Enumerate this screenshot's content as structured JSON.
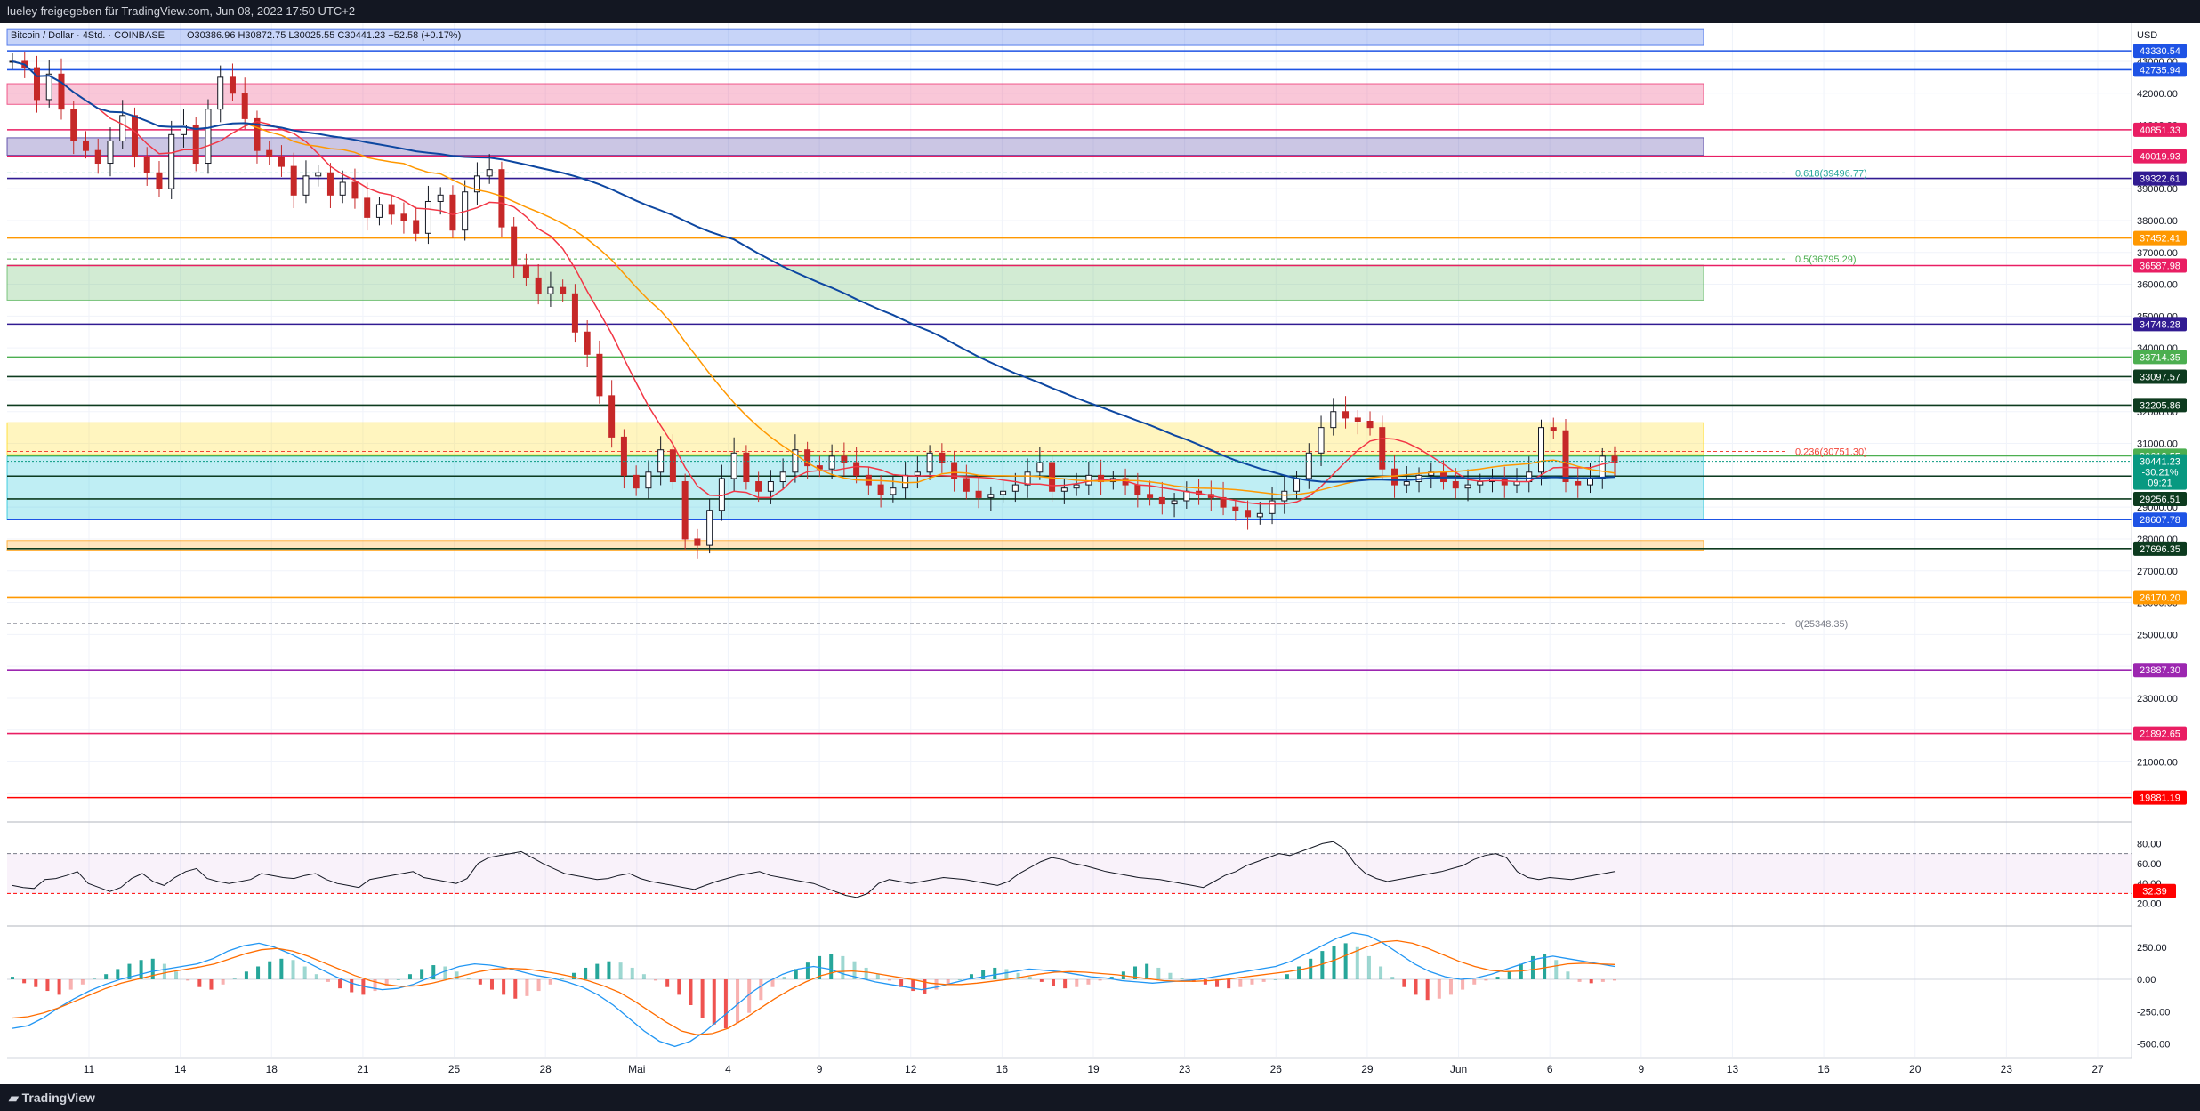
{
  "header": {
    "caption": "lueley freigegeben für TradingView.com, Jun 08, 2022 17:50 UTC+2"
  },
  "footer": {
    "brand": "TradingView"
  },
  "chart_data": {
    "type": "candlestick",
    "symbol_line": "Bitcoin / Dollar · 4Std. · COINBASE",
    "ohlc_readout": "O30386.96 H30872.75 L30025.55 C30441.23 +52.58 (+0.17%)",
    "currency": "USD",
    "x_ticks": [
      "11",
      "14",
      "18",
      "21",
      "25",
      "28",
      "Mai",
      "4",
      "9",
      "12",
      "16",
      "19",
      "23",
      "26",
      "29",
      "Jun",
      "6",
      "9",
      "13",
      "16",
      "20",
      "23",
      "27"
    ],
    "y_ticks": [
      43000,
      42000,
      41000,
      40000,
      39000,
      38000,
      37000,
      36000,
      35000,
      34000,
      33000,
      32000,
      31000,
      30000,
      29000,
      28000,
      27000,
      26000,
      25000,
      24000,
      23000,
      22000,
      21000,
      20000
    ],
    "ylim": [
      19200,
      44200
    ],
    "price_levels": [
      {
        "value": "43330.54",
        "color": "#1e53e5"
      },
      {
        "value": "42735.94",
        "color": "#1e53e5"
      },
      {
        "value": "40851.33",
        "color": "#e91e63"
      },
      {
        "value": "40019.93",
        "color": "#e91e63"
      },
      {
        "value": "39322.61",
        "color": "#311b92"
      },
      {
        "value": "37452.41",
        "color": "#ff9800"
      },
      {
        "value": "36587.98",
        "color": "#e91e63"
      },
      {
        "value": "34748.28",
        "color": "#311b92"
      },
      {
        "value": "33714.35",
        "color": "#4caf50"
      },
      {
        "value": "33097.57",
        "color": "#0d3b1f"
      },
      {
        "value": "32205.86",
        "color": "#0d3b1f"
      },
      {
        "value": "30612.55",
        "color": "#4caf50"
      },
      {
        "value": "29975.48",
        "color": "#0d3b1f"
      },
      {
        "value": "29256.51",
        "color": "#0d3b1f"
      },
      {
        "value": "28607.78",
        "color": "#1e53e5"
      },
      {
        "value": "27696.35",
        "color": "#0d3b1f"
      },
      {
        "value": "26170.20",
        "color": "#ff9800"
      },
      {
        "value": "23887.30",
        "color": "#9c27b0"
      },
      {
        "value": "21892.65",
        "color": "#e91e63"
      },
      {
        "value": "19881.19",
        "color": "#ff0000"
      }
    ],
    "current_price": {
      "price": "30441.23",
      "change": "-30.21%",
      "countdown": "09:21",
      "color": "#089981"
    },
    "zones": [
      {
        "from": 44000,
        "to": 43500,
        "color": "#1e53e5"
      },
      {
        "from": 42300,
        "to": 41650,
        "color": "#e91e63"
      },
      {
        "from": 40600,
        "to": 40050,
        "color": "#311b92"
      },
      {
        "from": 36600,
        "to": 35500,
        "color": "#4caf50"
      },
      {
        "from": 31650,
        "to": 30650,
        "color": "#ffd600"
      },
      {
        "from": 30600,
        "to": 28600,
        "color": "#00bcd4"
      },
      {
        "from": 27950,
        "to": 27650,
        "color": "#ff9800"
      }
    ],
    "fibonacci": [
      {
        "label": "0.618(39496.77)",
        "color": "#26a69a"
      },
      {
        "label": "0.5(36795.29)",
        "color": "#4caf50"
      },
      {
        "label": "0.236(30751.30)",
        "color": "#f44336"
      },
      {
        "label": "0(25348.35)",
        "color": "#787b86"
      }
    ],
    "close_series": [
      43000,
      42800,
      41800,
      42600,
      41500,
      40500,
      40200,
      39800,
      40500,
      41300,
      40000,
      39500,
      39000,
      40700,
      41000,
      39800,
      41500,
      42500,
      42000,
      41200,
      40200,
      40000,
      39700,
      38800,
      39400,
      39500,
      38800,
      39200,
      38700,
      38100,
      38500,
      38200,
      38000,
      37600,
      38600,
      38800,
      37700,
      38900,
      39400,
      39600,
      37800,
      36600,
      36200,
      35700,
      35900,
      35700,
      34500,
      33800,
      32500,
      31200,
      30000,
      29600,
      30100,
      30800,
      29800,
      28000,
      27800,
      28900,
      29900,
      30700,
      29800,
      29500,
      29800,
      30100,
      30800,
      30300,
      30200,
      30600,
      30400,
      30000,
      29700,
      29400,
      29600,
      30000,
      30100,
      30700,
      30400,
      29900,
      29500,
      29300,
      29400,
      29500,
      29700,
      30100,
      30400,
      29500,
      29600,
      29700,
      30000,
      29800,
      29900,
      29700,
      29400,
      29300,
      29100,
      29200,
      29500,
      29400,
      29300,
      29000,
      28900,
      28700,
      28800,
      29200,
      29500,
      29900,
      30700,
      31500,
      32000,
      31800,
      31700,
      31500,
      30200,
      29700,
      29800,
      30000,
      30100,
      29800,
      29600,
      29700,
      29800,
      29900,
      29700,
      29800,
      30100,
      31500,
      31400,
      29800,
      29700,
      29900,
      30600,
      30400
    ],
    "rsi": {
      "levels": [
        "80.00",
        "60.00",
        "40.00",
        "20.00"
      ],
      "value_label": "32.39",
      "ylim": [
        0,
        100
      ],
      "values": [
        38,
        36,
        35,
        44,
        45,
        48,
        52,
        40,
        36,
        32,
        36,
        45,
        50,
        42,
        38,
        46,
        52,
        55,
        45,
        42,
        40,
        42,
        44,
        50,
        48,
        46,
        45,
        48,
        50,
        44,
        40,
        38,
        36,
        44,
        46,
        48,
        50,
        52,
        46,
        44,
        42,
        40,
        45,
        60,
        66,
        68,
        70,
        72,
        66,
        60,
        55,
        50,
        48,
        46,
        44,
        45,
        48,
        50,
        45,
        42,
        40,
        38,
        36,
        34,
        38,
        42,
        45,
        48,
        50,
        52,
        48,
        46,
        44,
        42,
        40,
        36,
        32,
        28,
        26,
        30,
        40,
        44,
        42,
        40,
        42,
        44,
        46,
        45,
        44,
        42,
        40,
        38,
        42,
        50,
        56,
        62,
        66,
        64,
        60,
        58,
        55,
        52,
        50,
        48,
        46,
        45,
        44,
        42,
        40,
        38,
        36,
        42,
        48,
        52,
        58,
        62,
        66,
        70,
        68,
        72,
        76,
        80,
        82,
        75,
        60,
        50,
        45,
        42,
        44,
        46,
        48,
        50,
        52,
        55,
        58,
        64,
        68,
        70,
        66,
        52,
        46,
        44,
        46,
        45,
        44,
        46,
        48,
        50,
        52
      ],
      "color": "#131722"
    },
    "macd": {
      "levels": [
        "250.00",
        "0.00",
        "-250.00",
        "-500.00"
      ],
      "ylim": [
        -600,
        400
      ],
      "histogram": [
        20,
        -30,
        -60,
        -90,
        -120,
        -80,
        -40,
        10,
        40,
        80,
        120,
        150,
        160,
        120,
        60,
        -10,
        -60,
        -80,
        -40,
        10,
        60,
        100,
        140,
        160,
        150,
        100,
        40,
        -20,
        -70,
        -100,
        -120,
        -90,
        -50,
        0,
        40,
        80,
        110,
        100,
        60,
        10,
        -40,
        -80,
        -120,
        -150,
        -130,
        -90,
        -40,
        10,
        50,
        90,
        120,
        140,
        130,
        90,
        40,
        -10,
        -60,
        -120,
        -200,
        -300,
        -350,
        -380,
        -340,
        -260,
        -160,
        -60,
        20,
        80,
        130,
        180,
        200,
        180,
        140,
        90,
        40,
        -10,
        -60,
        -90,
        -110,
        -80,
        -40,
        0,
        40,
        70,
        90,
        80,
        50,
        20,
        -20,
        -50,
        -70,
        -60,
        -40,
        -10,
        20,
        60,
        100,
        120,
        90,
        50,
        10,
        -20,
        -40,
        -60,
        -70,
        -60,
        -40,
        -20,
        0,
        40,
        100,
        160,
        220,
        260,
        280,
        250,
        180,
        100,
        20,
        -60,
        -120,
        -160,
        -150,
        -120,
        -80,
        -40,
        -10,
        20,
        60,
        120,
        180,
        200,
        150,
        60,
        -20,
        -30,
        -20,
        -10
      ],
      "macd_line": [
        -380,
        -360,
        -300,
        -220,
        -150,
        -90,
        -40,
        0,
        30,
        60,
        80,
        100,
        120,
        160,
        220,
        260,
        280,
        250,
        200,
        140,
        80,
        20,
        -30,
        -60,
        -80,
        -70,
        -40,
        10,
        60,
        100,
        120,
        110,
        90,
        60,
        30,
        10,
        -20,
        -60,
        -120,
        -200,
        -300,
        -400,
        -480,
        -520,
        -480,
        -400,
        -300,
        -200,
        -100,
        -20,
        40,
        80,
        100,
        80,
        40,
        10,
        -20,
        -40,
        -60,
        -80,
        -60,
        -30,
        0,
        20,
        40,
        60,
        80,
        70,
        60,
        40,
        20,
        10,
        -10,
        -20,
        -30,
        -20,
        -10,
        0,
        20,
        40,
        60,
        80,
        100,
        140,
        200,
        260,
        320,
        360,
        340,
        280,
        200,
        120,
        60,
        20,
        0,
        10,
        40,
        80,
        120,
        160,
        180,
        160,
        140,
        120,
        100
      ],
      "signal_line": [
        -300,
        -290,
        -260,
        -220,
        -170,
        -120,
        -70,
        -30,
        0,
        30,
        55,
        75,
        95,
        120,
        160,
        200,
        230,
        240,
        220,
        180,
        130,
        80,
        30,
        -10,
        -40,
        -55,
        -50,
        -30,
        0,
        30,
        60,
        80,
        85,
        80,
        65,
        45,
        20,
        -10,
        -50,
        -100,
        -170,
        -250,
        -330,
        -400,
        -430,
        -420,
        -380,
        -310,
        -230,
        -150,
        -80,
        -20,
        30,
        60,
        65,
        55,
        35,
        15,
        -5,
        -30,
        -40,
        -40,
        -30,
        -15,
        0,
        20,
        40,
        55,
        60,
        55,
        45,
        35,
        20,
        5,
        -10,
        -15,
        -15,
        -10,
        0,
        15,
        30,
        45,
        60,
        80,
        110,
        150,
        200,
        250,
        290,
        300,
        280,
        240,
        190,
        140,
        100,
        70,
        60,
        65,
        80,
        100,
        120,
        125,
        120,
        115
      ],
      "color_pos": "#26a69a",
      "color_neg": "#ef5350",
      "macd_color": "#2196f3",
      "signal_color": "#ff6d00"
    }
  }
}
